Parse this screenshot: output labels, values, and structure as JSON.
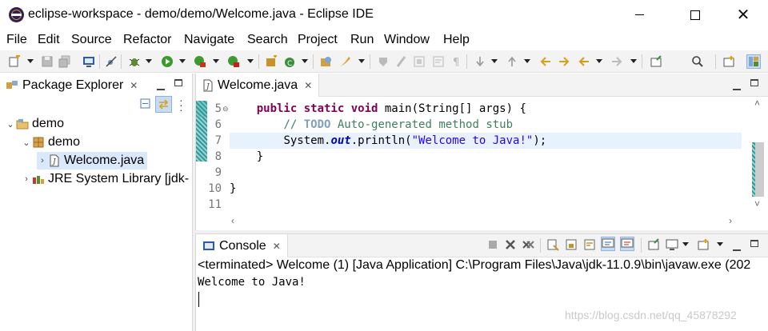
{
  "window": {
    "title": "eclipse-workspace - demo/demo/Welcome.java - Eclipse IDE",
    "minimize_label": "—",
    "maximize_label": "☐",
    "close_label": "✕"
  },
  "menu": {
    "items": [
      "File",
      "Edit",
      "Source",
      "Refactor",
      "Navigate",
      "Search",
      "Project",
      "Run",
      "Window",
      "Help"
    ]
  },
  "package_explorer": {
    "title": "Package Explorer",
    "tree": [
      {
        "label": "demo",
        "icon": "project-icon"
      },
      {
        "label": "demo",
        "icon": "package-icon"
      },
      {
        "label": "Welcome.java",
        "icon": "java-file-icon"
      },
      {
        "label": "JRE System Library [jdk-",
        "icon": "library-icon"
      }
    ]
  },
  "editor": {
    "tab_label": "Welcome.java",
    "lines": [
      {
        "num": "5"
      },
      {
        "num": "6"
      },
      {
        "num": "7"
      },
      {
        "num": "8"
      },
      {
        "num": "9"
      },
      {
        "num": "10"
      },
      {
        "num": "11"
      }
    ],
    "code": {
      "l5_kw": "public static void",
      "l5_rest": " main(String[] args) {",
      "l6_comment_start": "// ",
      "l6_todo": "TODO",
      "l6_comment_rest": " Auto-generated method stub",
      "l7_pre": "System.",
      "l7_field": "out",
      "l7_mid": ".println(",
      "l7_str": "\"Welcome to Java!\"",
      "l7_end": ");",
      "l8": "}",
      "l10": "}"
    }
  },
  "console": {
    "tab_label": "Console",
    "status": "<terminated> Welcome (1) [Java Application] C:\\Program Files\\Java\\jdk-11.0.9\\bin\\javaw.exe  (202",
    "output": "Welcome to Java!"
  },
  "watermark": "https://blog.csdn.net/qq_45878292",
  "colors": {
    "keyword": "#7f0055",
    "comment": "#3f7f5f",
    "string": "#2a00ff",
    "field": "#0000c0",
    "current_line": "#e8f2fe",
    "selection": "#d9e8fb"
  }
}
